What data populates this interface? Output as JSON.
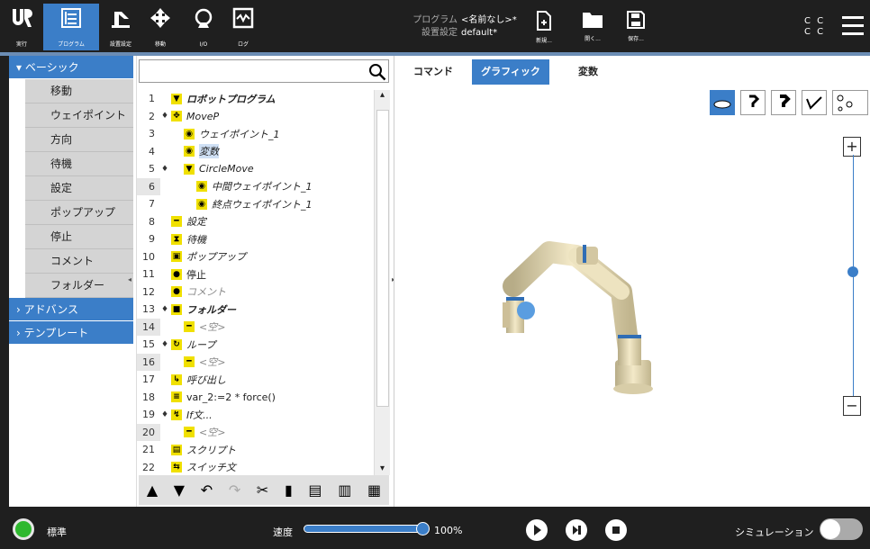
{
  "header": {
    "nav": [
      {
        "icon": "ur-logo-icon",
        "label": "実行"
      },
      {
        "icon": "program-tree-icon",
        "label": "プログラム"
      },
      {
        "icon": "installation-icon",
        "label": "設置設定"
      },
      {
        "icon": "move-icon",
        "label": "移動"
      },
      {
        "icon": "io-icon",
        "label": "I/O"
      },
      {
        "icon": "log-icon",
        "label": "ログ"
      }
    ],
    "program_label": "プログラム",
    "program_value": "<名前なし>*",
    "installation_label": "設置設定",
    "installation_value": "default*",
    "file_buttons": [
      {
        "icon": "new-file-icon",
        "label": "新規..."
      },
      {
        "icon": "open-folder-icon",
        "label": "開く..."
      },
      {
        "icon": "save-icon",
        "label": "保存..."
      }
    ],
    "cc_top": "C C",
    "cc_bottom": "C C"
  },
  "sidebar": {
    "basic_header": "ベーシック",
    "items": [
      "移動",
      "ウェイポイント",
      "方向",
      "待機",
      "設定",
      "ポップアップ",
      "停止",
      "コメント",
      "フォルダー"
    ],
    "advanced_header": "アドバンス",
    "template_header": "テンプレート"
  },
  "search": {
    "value": "",
    "placeholder": ""
  },
  "program_tree": [
    {
      "n": "1",
      "icon": "▼",
      "text": "ロボットプログラム",
      "indent": 0,
      "style": "b",
      "pin": false
    },
    {
      "n": "2",
      "icon": "✥",
      "text": "MoveP",
      "indent": 0,
      "style": "",
      "pin": true
    },
    {
      "n": "3",
      "icon": "◉",
      "text": "ウェイポイント_1",
      "indent": 1,
      "style": "",
      "pin": false
    },
    {
      "n": "4",
      "icon": "◉",
      "text": "変数",
      "indent": 1,
      "style": "sel",
      "pin": false
    },
    {
      "n": "5",
      "icon": "▼",
      "text": "CircleMove",
      "indent": 1,
      "style": "",
      "pin": true
    },
    {
      "n": "6",
      "icon": "◉",
      "text": "中間ウェイポイント_1",
      "indent": 2,
      "style": "",
      "pin": false,
      "hl": true
    },
    {
      "n": "7",
      "icon": "◉",
      "text": "終点ウェイポイント_1",
      "indent": 2,
      "style": "",
      "pin": false
    },
    {
      "n": "8",
      "icon": "━",
      "text": "設定",
      "indent": 0,
      "style": "",
      "pin": false
    },
    {
      "n": "9",
      "icon": "⧗",
      "text": "待機",
      "indent": 0,
      "style": "",
      "pin": false
    },
    {
      "n": "10",
      "icon": "▣",
      "text": "ポップアップ",
      "indent": 0,
      "style": "",
      "pin": false
    },
    {
      "n": "11",
      "icon": "●",
      "text": "停止",
      "indent": 0,
      "style": "norm",
      "pin": false
    },
    {
      "n": "12",
      "icon": "●",
      "text": "コメント",
      "indent": 0,
      "style": "gray",
      "pin": false
    },
    {
      "n": "13",
      "icon": "■",
      "text": "フォルダー",
      "indent": 0,
      "style": "b",
      "pin": true
    },
    {
      "n": "14",
      "icon": "━",
      "text": "<空>",
      "indent": 1,
      "style": "gray",
      "pin": false,
      "hl": true
    },
    {
      "n": "15",
      "icon": "↻",
      "text": "ループ",
      "indent": 0,
      "style": "",
      "pin": true
    },
    {
      "n": "16",
      "icon": "━",
      "text": "<空>",
      "indent": 1,
      "style": "gray",
      "pin": false,
      "hl": true
    },
    {
      "n": "17",
      "icon": "↳",
      "text": "呼び出し",
      "indent": 0,
      "style": "",
      "pin": false
    },
    {
      "n": "18",
      "icon": "≡",
      "text": "var_2:=2 * force()",
      "indent": 0,
      "style": "norm",
      "pin": false
    },
    {
      "n": "19",
      "icon": "↯",
      "text": "If文...",
      "indent": 0,
      "style": "",
      "pin": true
    },
    {
      "n": "20",
      "icon": "━",
      "text": "<空>",
      "indent": 1,
      "style": "gray",
      "pin": false,
      "hl": true
    },
    {
      "n": "21",
      "icon": "▤",
      "text": "スクリプト",
      "indent": 0,
      "style": "",
      "pin": false
    },
    {
      "n": "22",
      "icon": "⇆",
      "text": "スイッチ文",
      "indent": 0,
      "style": "",
      "pin": false
    }
  ],
  "tabs": [
    "コマンド",
    "グラフィック",
    "変数"
  ],
  "active_tab": "グラフィック",
  "view_buttons": [
    "view-floor-icon",
    "view-side-left-icon",
    "view-side-right-icon",
    "view-path-icon",
    "view-joints-icon"
  ],
  "zoom": {
    "plus": "+",
    "minus": "−"
  },
  "footer": {
    "status_label": "標準",
    "speed_label": "速度",
    "speed_value": "100%",
    "speed_fraction": 1.0,
    "simulation_label": "シミュレーション"
  },
  "colors": {
    "accent": "#3b7ec8",
    "icon_yellow": "#f0e000",
    "status_green": "#2eb82e"
  }
}
